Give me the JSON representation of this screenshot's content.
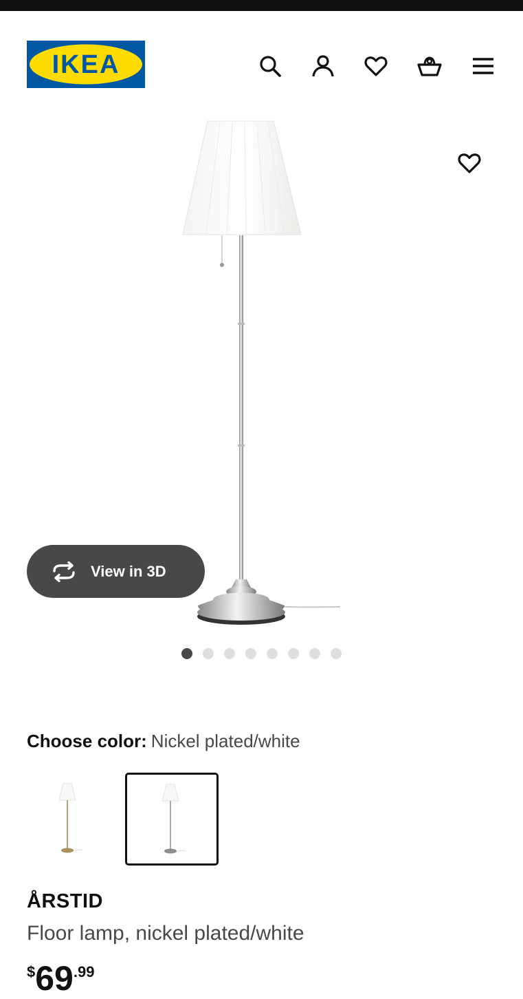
{
  "header": {
    "logo_text": "IKEA",
    "icons": [
      "search-icon",
      "account-icon",
      "favorites-icon",
      "cart-icon",
      "menu-icon"
    ]
  },
  "gallery": {
    "favorite_icon": "heart-outline-icon",
    "view_3d_label": "View in 3D",
    "view_3d_icon": "rotate-arrows-icon",
    "total_images": 8,
    "active_image": 1
  },
  "color_picker": {
    "label": "Choose color:",
    "selected_value": "Nickel plated/white",
    "options": [
      {
        "swatch": "brass-lamp-thumbnail",
        "selected": false
      },
      {
        "swatch": "nickel-lamp-thumbnail",
        "selected": true
      }
    ]
  },
  "product": {
    "name": "ÅRSTID",
    "description": "Floor lamp, nickel plated/white",
    "price": {
      "currency": "$",
      "integer": "69",
      "decimal": ".99"
    }
  },
  "colors": {
    "brand_blue": "#0058A3",
    "brand_yellow": "#FFDB00",
    "text_primary": "#111111",
    "text_secondary": "#484848",
    "button_dark": "#484848",
    "dot_inactive": "#DFDFDF"
  }
}
